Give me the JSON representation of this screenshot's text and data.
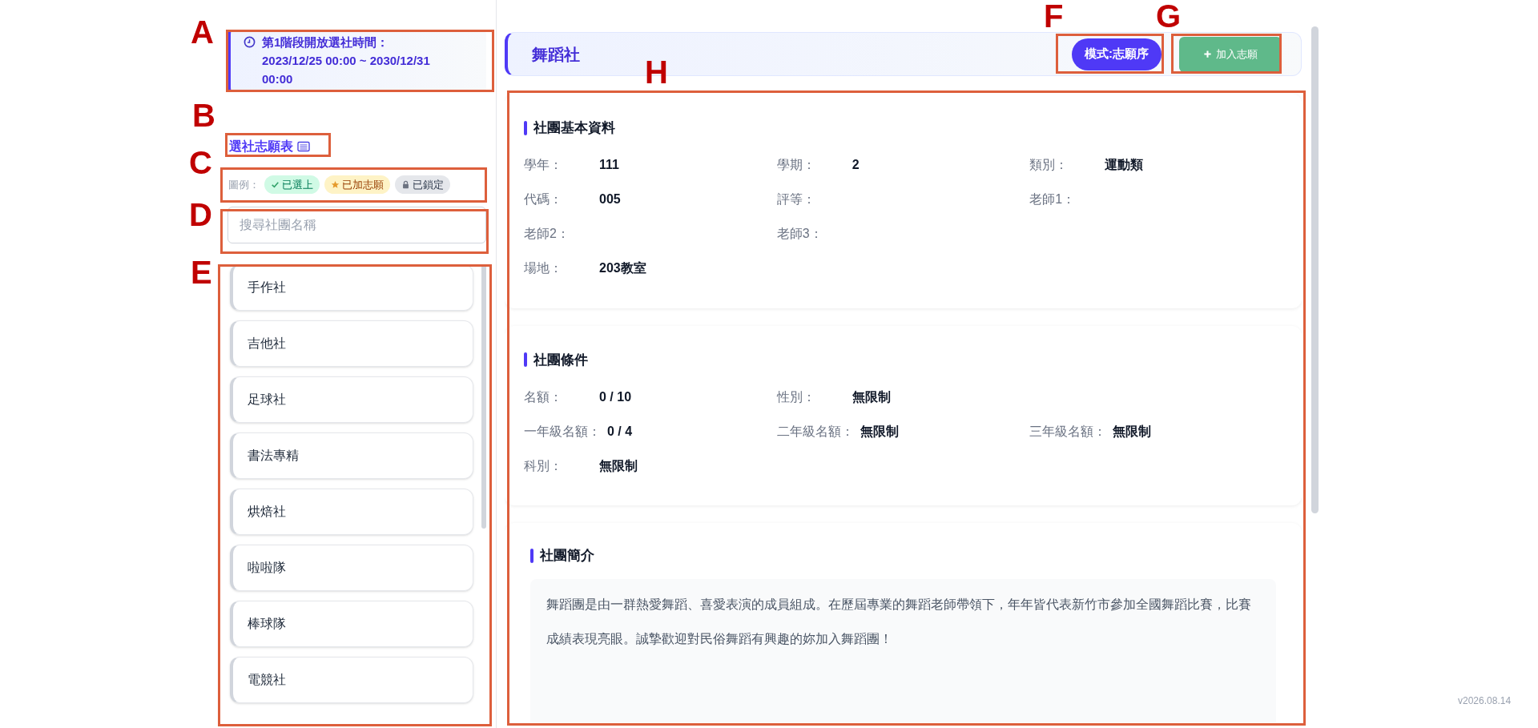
{
  "notice": {
    "title": "第1階段開放選社時間：",
    "period": "2023/12/25 00:00 ~ 2030/12/31 00:00"
  },
  "wishlist_link": "選社志願表",
  "legend": {
    "label": "圖例：",
    "items": [
      {
        "kind": "selected",
        "label": "已選上"
      },
      {
        "kind": "wish",
        "label": "已加志願"
      },
      {
        "kind": "locked",
        "label": "已鎖定"
      }
    ]
  },
  "search": {
    "placeholder": "搜尋社團名稱"
  },
  "clubs": [
    "手作社",
    "吉他社",
    "足球社",
    "書法專精",
    "烘焙社",
    "啦啦隊",
    "棒球隊",
    "電競社"
  ],
  "header": {
    "title": "舞蹈社",
    "mode_badge": "模式:志願序",
    "add_button": "加入志願"
  },
  "sections": [
    {
      "title": "社團基本資料",
      "rows": [
        [
          {
            "label": "學年：",
            "value": "111"
          },
          {
            "label": "學期：",
            "value": "2"
          },
          {
            "label": "類別：",
            "value": "運動類"
          }
        ],
        [
          {
            "label": "代碼：",
            "value": "005"
          },
          {
            "label": "評等："
          },
          {
            "label": "老師1："
          }
        ],
        [
          {
            "label": "老師2："
          },
          {
            "label": "老師3："
          }
        ],
        [
          {
            "label": "場地：",
            "value": "203教室"
          }
        ]
      ]
    },
    {
      "title": "社團條件",
      "rows": [
        [
          {
            "label": "名額：",
            "value": "0 / 10"
          },
          {
            "label": "性別：",
            "value": "無限制"
          }
        ],
        [
          {
            "label": "一年級名額：",
            "value": "0 / 4"
          },
          {
            "label": "二年級名額：",
            "value": "無限制"
          },
          {
            "label": "三年級名額：",
            "value": "無限制"
          }
        ],
        [
          {
            "label": "科別：",
            "value": "無限制"
          }
        ]
      ]
    },
    {
      "title": "社團簡介",
      "description": "舞蹈團是由一群熱愛舞蹈、喜愛表演的成員組成。在歷屆專業的舞蹈老師帶領下，年年皆代表新竹市參加全國舞蹈比賽，比賽成績表現亮眼。誠摯歡迎對民俗舞蹈有興趣的妳加入舞蹈團！"
    }
  ],
  "version": "v2026.08.14",
  "annotations": [
    "A",
    "B",
    "C",
    "D",
    "E",
    "F",
    "G",
    "H"
  ]
}
